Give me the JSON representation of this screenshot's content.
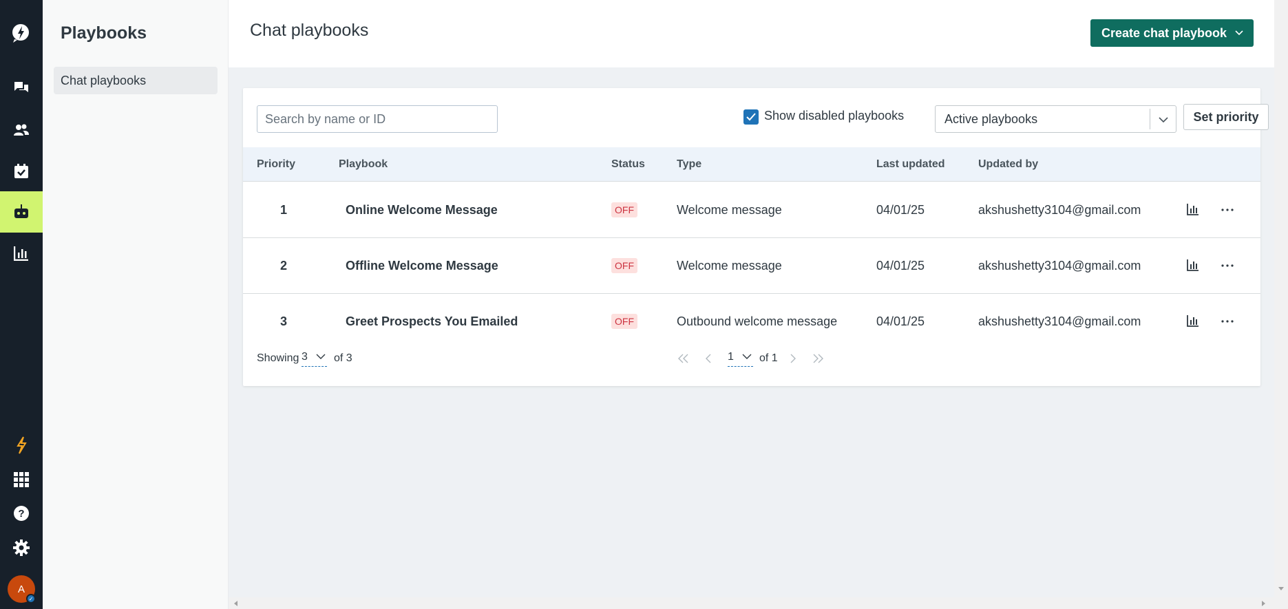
{
  "rail": {
    "items": [
      {
        "name": "logo",
        "icon": "zendesk-logo-icon"
      },
      {
        "name": "conversations",
        "icon": "chat-bubbles-icon"
      },
      {
        "name": "contacts",
        "icon": "users-icon"
      },
      {
        "name": "calendar",
        "icon": "calendar-check-icon"
      },
      {
        "name": "bots",
        "icon": "robot-icon",
        "active": true
      },
      {
        "name": "analytics",
        "icon": "bar-chart-icon"
      },
      {
        "name": "upgrade",
        "icon": "lightning-icon"
      },
      {
        "name": "apps",
        "icon": "grid-icon"
      },
      {
        "name": "help",
        "icon": "help-icon"
      },
      {
        "name": "settings",
        "icon": "gear-icon"
      }
    ],
    "avatar_initial": "A",
    "active_color": "#d1f470"
  },
  "subnav": {
    "title": "Playbooks",
    "items": [
      {
        "label": "Chat playbooks"
      }
    ]
  },
  "main": {
    "title": "Chat playbooks",
    "create_button": "Create chat playbook",
    "search_placeholder": "Search by name or ID",
    "show_disabled_label": "Show disabled playbooks",
    "show_disabled_checked": true,
    "filter_selected": "Active playbooks",
    "set_priority_label": "Set priority",
    "columns": [
      "Priority",
      "Playbook",
      "Status",
      "Type",
      "Last updated",
      "Updated by"
    ],
    "rows": [
      {
        "priority": "1",
        "playbook": "Online Welcome Message",
        "status": "OFF",
        "type": "Welcome message",
        "last_updated": "04/01/25",
        "updated_by": "akshushetty3104@gmail.com"
      },
      {
        "priority": "2",
        "playbook": "Offline Welcome Message",
        "status": "OFF",
        "type": "Welcome message",
        "last_updated": "04/01/25",
        "updated_by": "akshushetty3104@gmail.com"
      },
      {
        "priority": "3",
        "playbook": "Greet Prospects You Emailed",
        "status": "OFF",
        "type": "Outbound welcome message",
        "last_updated": "04/01/25",
        "updated_by": "akshushetty3104@gmail.com"
      }
    ],
    "footer": {
      "showing_label": "Showing",
      "page_size": "3",
      "of_total": "of 3",
      "page": "1",
      "of_pages": "of 1"
    }
  },
  "colors": {
    "primary_button": "#0f6d5f",
    "checkbox": "#1f73b7",
    "off_badge_bg": "#fde0de"
  }
}
